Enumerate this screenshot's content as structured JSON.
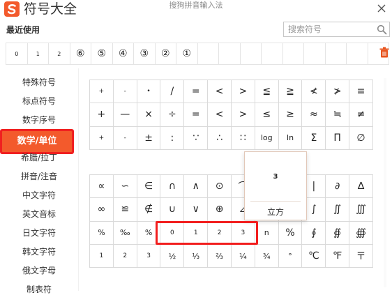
{
  "window": {
    "title": "符号大全",
    "subtitle": "搜狗拼音输入法"
  },
  "colors": {
    "accent": "#f35a2c",
    "highlight": "#f21e1e",
    "trash": "#e8541e"
  },
  "recent": {
    "label": "最近使用",
    "symbols": [
      "0",
      "1",
      "2",
      "⑥",
      "⑤",
      "④",
      "③",
      "②",
      "①",
      "",
      "",
      "",
      "",
      "",
      "",
      "",
      "",
      ""
    ]
  },
  "search": {
    "placeholder": "搜索符号"
  },
  "sidebar": {
    "items": [
      "特殊符号",
      "标点符号",
      "数字序号",
      "数学/单位",
      "希腊/拉丁",
      "拼音/注音",
      "中文字符",
      "英文音标",
      "日文字符",
      "韩文字符",
      "俄文字母",
      "制表符"
    ],
    "active_index": 3
  },
  "grid_top": [
    "+",
    "-",
    "•",
    "/",
    "=",
    "<",
    ">",
    "≦",
    "≧",
    "≮",
    "≯",
    "≡",
    "+",
    "—",
    "×",
    "÷",
    "=",
    "<",
    ">",
    "≤",
    "≥",
    "≈",
    "≒",
    "≠",
    "+",
    "-",
    "±",
    ":",
    "∵",
    "∴",
    "∷",
    "log",
    "ln",
    "Σ",
    "Π",
    "∅"
  ],
  "grid_bottom": [
    "∝",
    "∽",
    "∈",
    "∩",
    "∧",
    "⊙",
    "⌒",
    "",
    "",
    "|",
    "∂",
    "∆",
    "∞",
    "≌",
    "∉",
    "∪",
    "∨",
    "⊕",
    "⊿",
    "",
    "",
    "∫",
    "∬",
    "∭",
    "%",
    "‰",
    "%",
    "0",
    "1",
    "2",
    "3",
    "n",
    "%",
    "∮",
    "∯",
    "∰",
    "1",
    "2",
    "3",
    "½",
    "⅓",
    "⅔",
    "¼",
    "¾",
    "°",
    "℃",
    "℉",
    "〒"
  ],
  "popup": {
    "char": "3",
    "name": "立方"
  }
}
